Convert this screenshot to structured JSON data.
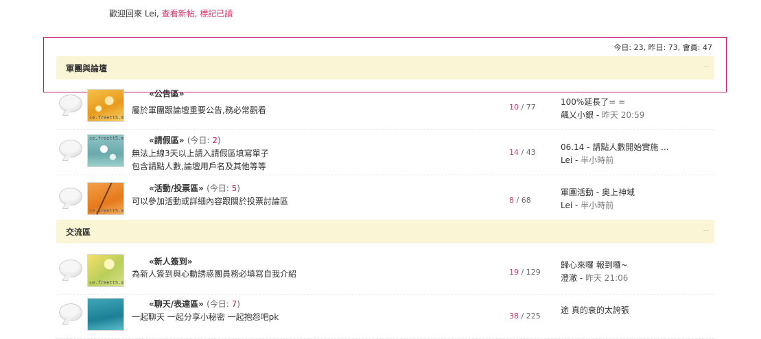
{
  "welcome": {
    "prefix": "歡迎回來 Lei, ",
    "new_posts": "查看新帖",
    "sep": ", ",
    "mark_read": "標記已讀"
  },
  "stats": {
    "text": "今日: 23, 昨日: 73, 會員: 47"
  },
  "categories": [
    {
      "title": "軍團與論壇"
    },
    {
      "title": "交流區"
    }
  ],
  "forums": [
    {
      "name": "«公告區»",
      "today_label": "",
      "today_count": "",
      "desc1": "屬於軍團跟論壇重要公告,務必常觀看",
      "desc2": "",
      "topics": "10",
      "posts": "77",
      "last_title": "100%延長了= =",
      "last_user": "飆乂小銀",
      "last_time": "昨天 20:59",
      "thumb_tag": "ce.freett5.me"
    },
    {
      "name": "«請假區»",
      "today_label": "(今日: ",
      "today_count": "2",
      "desc1": "無法上線3天以上請入請假區填寫單子",
      "desc2": "包含請點人數,論壇用戶名及其他等等",
      "topics": "14",
      "posts": "43",
      "last_title": "06.14 - 請點人數開始實施 ...",
      "last_user": "Lei",
      "last_time": "半小時前",
      "thumb_tag": "ce.freett5.me"
    },
    {
      "name": "«活動/投票區»",
      "today_label": "(今日: ",
      "today_count": "5",
      "desc1": "可以參加活動或詳細內容跟關於投票討論區",
      "desc2": "",
      "topics": "8",
      "posts": "68",
      "last_title": "軍團活動 - 奧上神域",
      "last_user": "Lei",
      "last_time": "半小時前",
      "thumb_tag": "ce.freett5.me"
    },
    {
      "name": "«新人簽到»",
      "today_label": "",
      "today_count": "",
      "desc1": "為新人簽到與心動誘惑團員務必填寫自我介紹",
      "desc2": "",
      "topics": "19",
      "posts": "129",
      "last_title": "歸心來囉 報到囉~",
      "last_user": "澄澈",
      "last_time": "昨天 21:06",
      "thumb_tag": "ce.freett5.me"
    },
    {
      "name": "«聊天/表達區»",
      "today_label": "(今日: ",
      "today_count": "7",
      "desc1": "一起聊天 一起分享小秘密 一起抱怨吧pk",
      "desc2": "",
      "topics": "38",
      "posts": "225",
      "last_title": "途 真的衰的太誇張",
      "last_user": "",
      "last_time": "",
      "thumb_tag": ""
    }
  ]
}
